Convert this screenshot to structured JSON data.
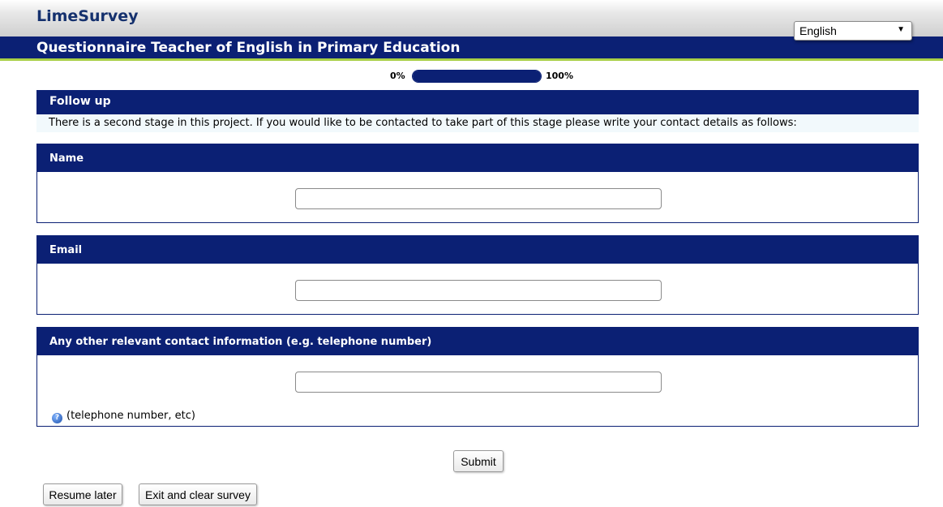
{
  "header": {
    "brand": "LimeSurvey",
    "survey_title": "Questionnaire Teacher of English in Primary Education",
    "language": {
      "selected": "English",
      "arrow": "▼"
    }
  },
  "progress": {
    "min_label": "0%",
    "max_label": "100%",
    "value_percent": 100
  },
  "group": {
    "title": "Follow up",
    "description": "There is a second stage in this project. If you would like to be contacted to take part of this stage please write your contact details as follows:"
  },
  "questions": [
    {
      "label": "Name",
      "value": ""
    },
    {
      "label": "Email",
      "value": ""
    },
    {
      "label": "Any other relevant contact information (e.g. telephone number)",
      "value": "",
      "help": "(telephone number, etc)"
    }
  ],
  "buttons": {
    "submit": "Submit",
    "resume_later": "Resume later",
    "exit_clear": "Exit and clear survey"
  },
  "colors": {
    "navy": "#0b2074",
    "accent_green": "#a9cf46",
    "brand_text": "#15316e"
  },
  "icons": {
    "help": "question-circle-icon",
    "dropdown": "caret-down-icon"
  }
}
